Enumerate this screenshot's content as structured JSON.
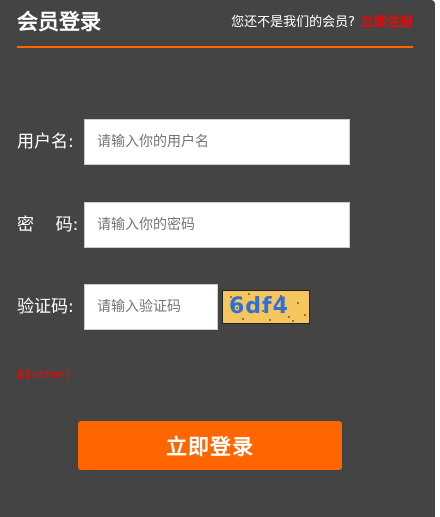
{
  "header": {
    "title": "会员登录",
    "prompt": "您还不是我们的会员?",
    "register_link": "立即注册"
  },
  "form": {
    "username": {
      "label": "用户名:",
      "placeholder": "请输入你的用户名",
      "value": ""
    },
    "password": {
      "label": "密    码:",
      "placeholder": "请输入你的密码",
      "value": ""
    },
    "captcha": {
      "label": "验证码:",
      "placeholder": "请输入验证码",
      "value": "",
      "image_text": "6df4"
    },
    "error": "${error}",
    "submit_label": "立即登录"
  },
  "colors": {
    "panel_bg": "#444444",
    "accent": "#ff6600",
    "link": "#ff0000",
    "captcha_bg": "#f5c65e",
    "captcha_text": "#2f6fd6"
  }
}
